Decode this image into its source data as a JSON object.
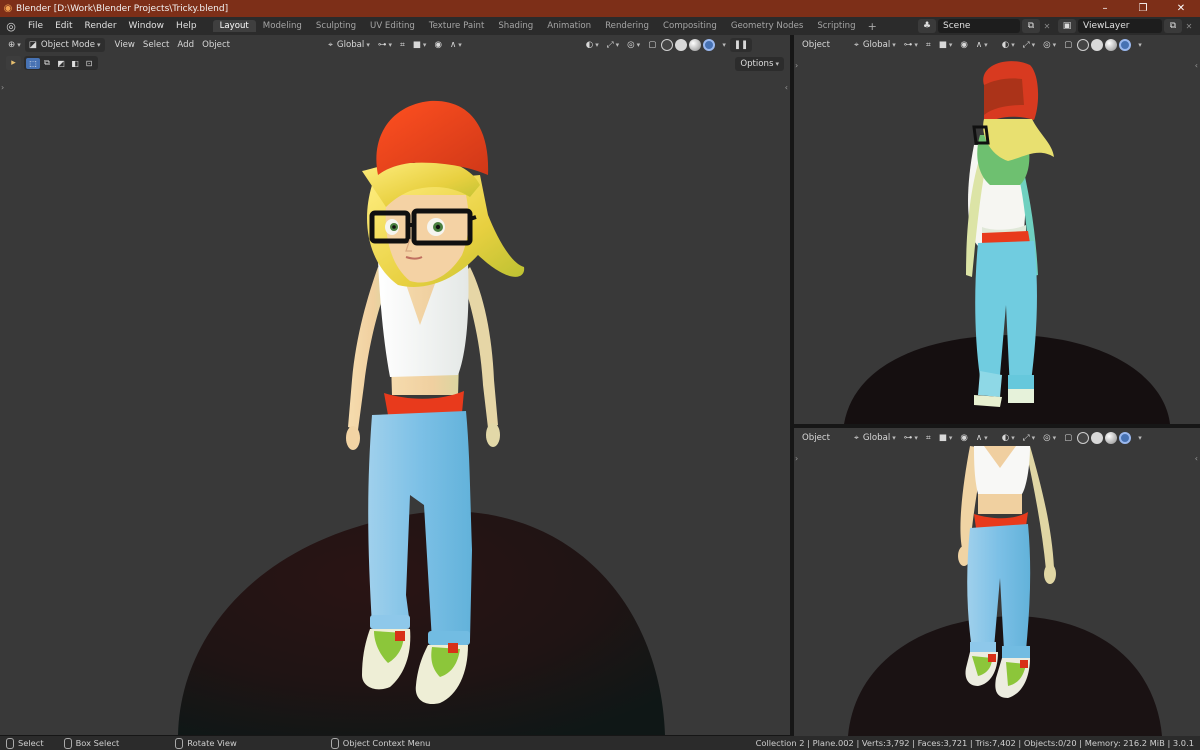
{
  "window": {
    "title": "Blender [D:\\Work\\Blender Projects\\Tricky.blend]",
    "minimize": "–",
    "maximize": "❐",
    "close": "✕"
  },
  "menubar": {
    "items": [
      "File",
      "Edit",
      "Render",
      "Window",
      "Help"
    ]
  },
  "workspaces": {
    "tabs": [
      "Layout",
      "Modeling",
      "Sculpting",
      "UV Editing",
      "Texture Paint",
      "Shading",
      "Animation",
      "Rendering",
      "Compositing",
      "Geometry Nodes",
      "Scripting"
    ],
    "active": "Layout",
    "add": "+"
  },
  "scene": {
    "name": "Scene"
  },
  "view_layer": {
    "name": "ViewLayer"
  },
  "main_viewport": {
    "mode": "Object Mode",
    "menus": [
      "View",
      "Select",
      "Add",
      "Object"
    ],
    "transform_orientation": "Global",
    "options": "Options"
  },
  "top_right_viewport": {
    "object_menu": "Object",
    "transform_orientation": "Global"
  },
  "bottom_right_viewport": {
    "object_menu": "Object",
    "transform_orientation": "Global"
  },
  "statusbar": {
    "select": "Select",
    "box_select": "Box Select",
    "rotate_view": "Rotate View",
    "context_menu": "Object Context Menu",
    "stats": "Collection 2 | Plane.002 | Verts:3,792 | Faces:3,721 | Tris:7,402 | Objects:0/20 | Memory: 216.2 MiB | 3.0.1"
  },
  "colors": {
    "titlebar": "#7d2f18",
    "accent_blue": "#4772b3",
    "viewport_bg": "#393939"
  }
}
